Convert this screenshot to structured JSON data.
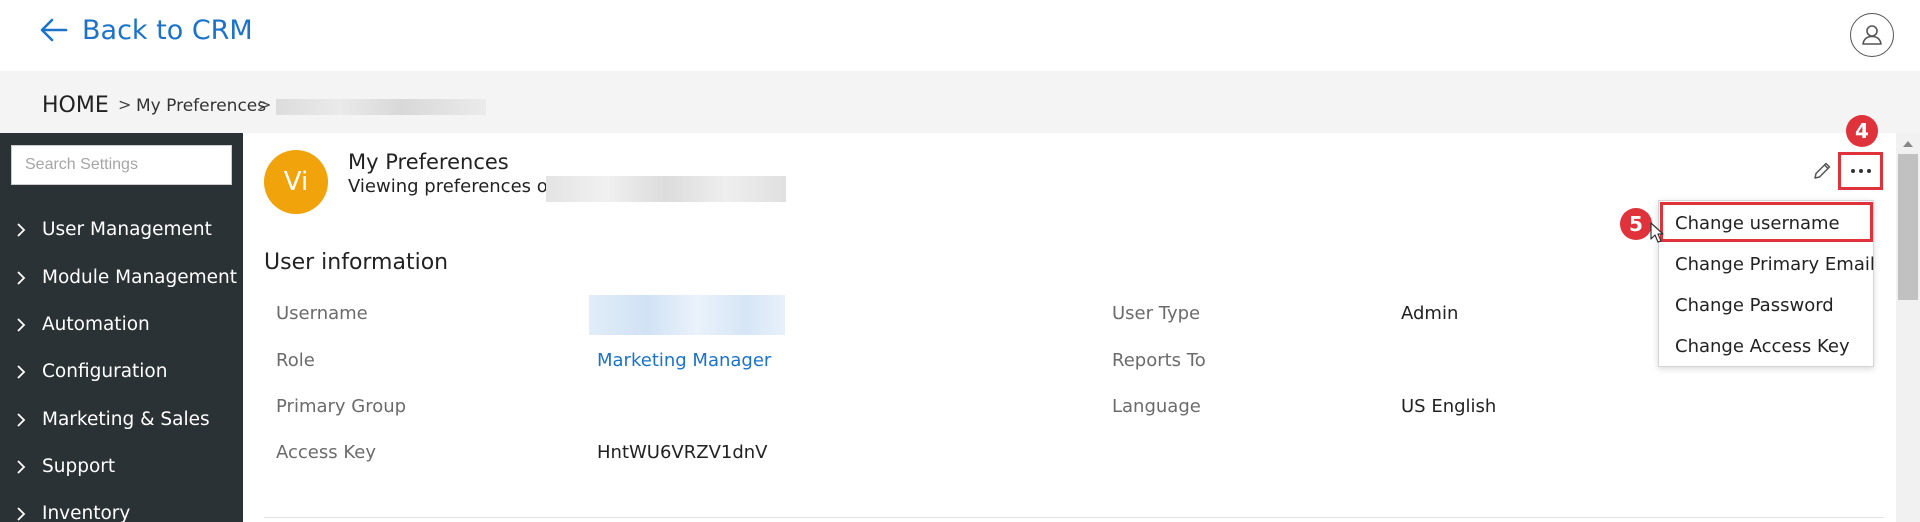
{
  "header": {
    "back_label": "Back to CRM"
  },
  "breadcrumb": {
    "home": "HOME",
    "separator": ">",
    "prefs": "My Preferences"
  },
  "sidebar": {
    "search_placeholder": "Search Settings",
    "items": [
      {
        "label": "User Management"
      },
      {
        "label": "Module Management"
      },
      {
        "label": "Automation"
      },
      {
        "label": "Configuration"
      },
      {
        "label": "Marketing & Sales"
      },
      {
        "label": "Support"
      },
      {
        "label": "Inventory"
      }
    ]
  },
  "profile": {
    "avatar_initials": "Vi",
    "title": "My Preferences",
    "subtitle": "Viewing preferences of"
  },
  "user_info": {
    "section_title": "User information",
    "left": [
      {
        "label": "Username",
        "value": ""
      },
      {
        "label": "Role",
        "value": "Marketing Manager"
      },
      {
        "label": "Primary Group",
        "value": ""
      },
      {
        "label": "Access Key",
        "value": "HntWU6VRZV1dnV"
      }
    ],
    "right": [
      {
        "label": "User Type",
        "value": "Admin"
      },
      {
        "label": "Reports To",
        "value": ""
      },
      {
        "label": "Language",
        "value": "US English"
      }
    ]
  },
  "actions_menu": {
    "items": [
      {
        "label": "Change username"
      },
      {
        "label": "Change Primary Email"
      },
      {
        "label": "Change Password"
      },
      {
        "label": "Change Access Key"
      }
    ]
  },
  "annotations": {
    "step4": "4",
    "step5": "5"
  },
  "colors": {
    "accent": "#1a73c9",
    "sidebar_bg": "#2b3236",
    "avatar_bg": "#f0a30a",
    "highlight": "#e0323a"
  }
}
